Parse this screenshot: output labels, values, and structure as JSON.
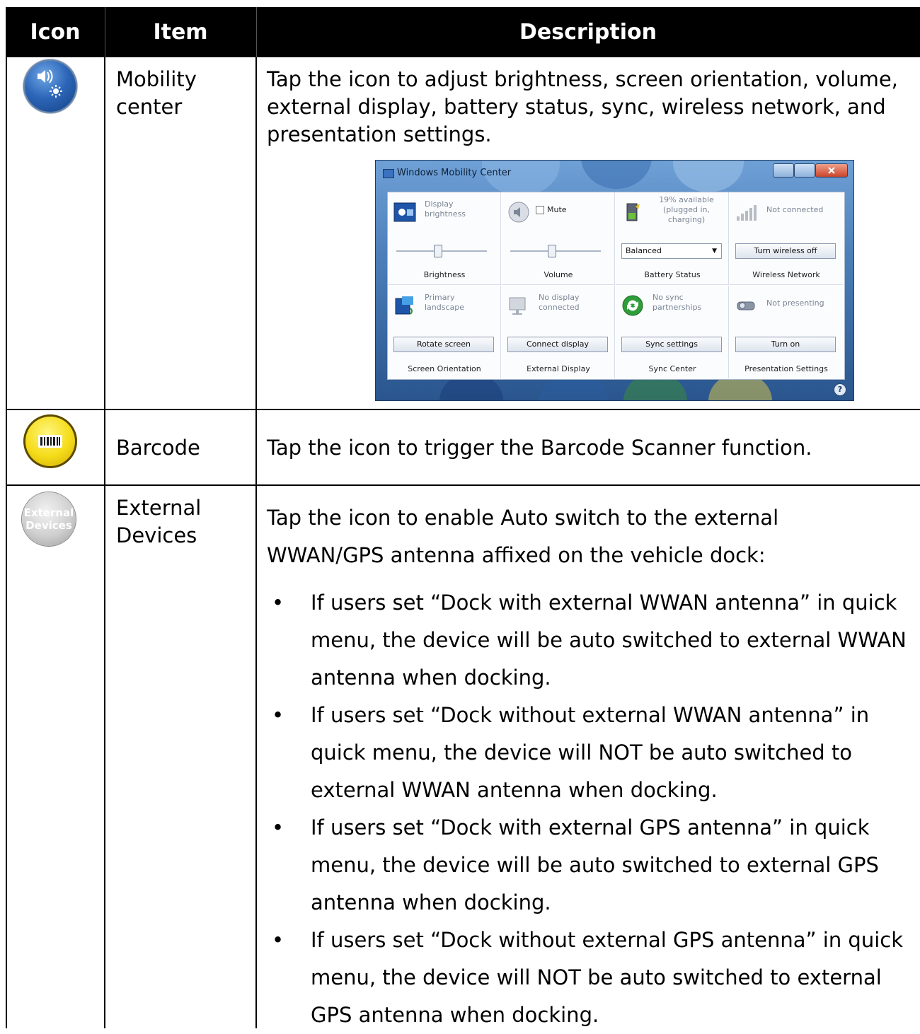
{
  "table": {
    "headers": {
      "icon": "Icon",
      "item": "Item",
      "description": "Description"
    },
    "rows": [
      {
        "icon": "mobility-center-icon",
        "item": "Mobility center",
        "description": "Tap the icon to adjust brightness, screen orientation, volume, external display, battery status, sync, wireless network, and presentation settings."
      },
      {
        "icon": "barcode-icon",
        "item": "Barcode",
        "description": "Tap the icon to trigger the Barcode Scanner function."
      },
      {
        "icon": "external-devices-icon",
        "icon_text": [
          "External",
          "Devices"
        ],
        "item": "External Devices",
        "description": "Tap the icon to enable Auto switch to the external WWAN/GPS antenna affixed on the vehicle dock:",
        "bullets": [
          "If users set “Dock with external WWAN antenna” in quick menu, the device will be auto switched to external WWAN antenna when docking.",
          "If users set “Dock without external WWAN antenna” in quick menu, the device will NOT be auto switched to external WWAN antenna when docking.",
          "If users set “Dock with external GPS antenna” in quick menu, the device will be auto switched to external GPS antenna when docking.",
          "If users set “Dock without external GPS antenna” in quick menu, the device will NOT be auto switched to external GPS antenna when docking."
        ]
      }
    ]
  },
  "mobility_window": {
    "title": "Windows Mobility Center",
    "help": "?",
    "tiles": [
      {
        "status": "Display brightness",
        "control": "slider",
        "level": 0.45,
        "label": "Brightness"
      },
      {
        "status": "Mute",
        "control": "slider",
        "level": 0.45,
        "label": "Volume"
      },
      {
        "status": "19% available (plugged in, charging)",
        "control": "select",
        "value": "Balanced",
        "label": "Battery Status"
      },
      {
        "status": "Not connected",
        "control": "button",
        "button": "Turn wireless off",
        "label": "Wireless Network"
      },
      {
        "status": "Primary landscape",
        "control": "button",
        "button": "Rotate screen",
        "label": "Screen Orientation"
      },
      {
        "status": "No display connected",
        "control": "button",
        "button": "Connect display",
        "label": "External Display"
      },
      {
        "status": "No sync partnerships",
        "control": "button",
        "button": "Sync settings",
        "label": "Sync Center"
      },
      {
        "status": "Not presenting",
        "control": "button",
        "button": "Turn on",
        "label": "Presentation Settings"
      }
    ]
  }
}
